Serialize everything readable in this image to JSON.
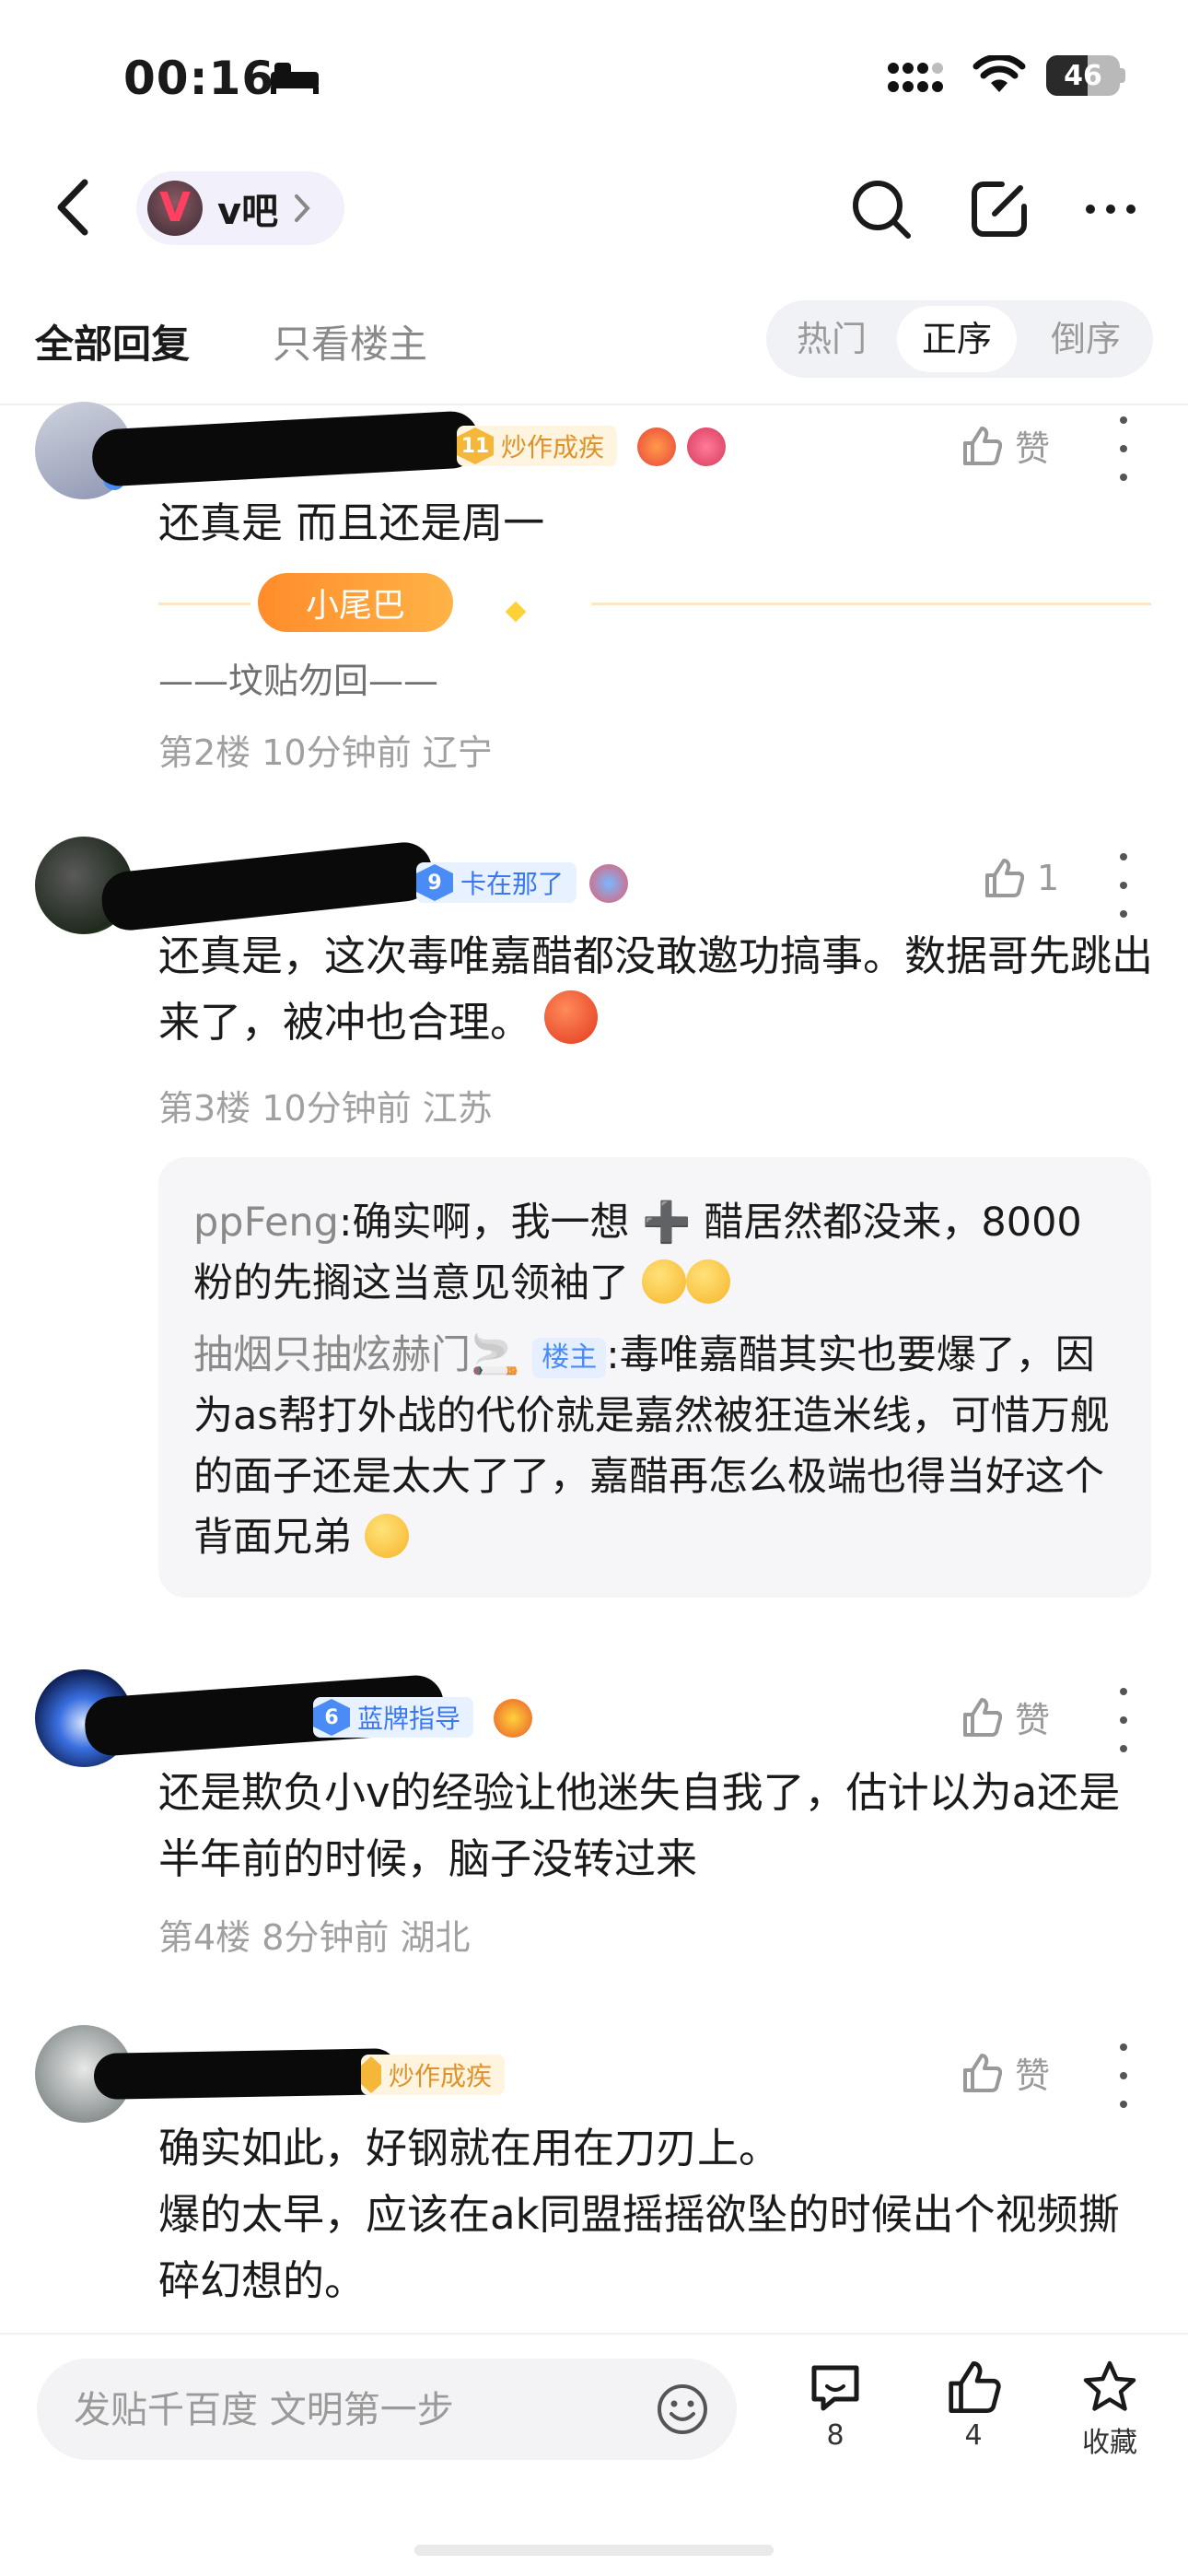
{
  "status_bar": {
    "time": "00:16",
    "battery": "46"
  },
  "nav": {
    "forum_name": "v吧"
  },
  "tabs": {
    "all_replies": "全部回复",
    "op_only": "只看楼主"
  },
  "sort": {
    "hot": "热门",
    "asc": "正序",
    "desc": "倒序",
    "selected": "正序"
  },
  "posts": [
    {
      "level": "11",
      "title": "炒作成疾",
      "likes": "赞",
      "text": "还真是 而且还是周一",
      "tail_badge": "小尾巴",
      "signature": "——坟贴勿回——",
      "meta": "第2楼 10分钟前 辽宁"
    },
    {
      "level": "9",
      "title": "卡在那了",
      "likes": "1",
      "text": "还真是，这次毒唯嘉醋都没敢邀功搞事。数据哥先跳出来了，被冲也合理。",
      "meta": "第3楼 10分钟前 江苏",
      "replies": [
        {
          "author": "ppFeng",
          "text": ":确实啊，我一想 ➕ 醋居然都没来，8000粉的先搁这当意见领袖了"
        },
        {
          "author": "抽烟只抽炫赫门🚬",
          "op_tag": "楼主",
          "text": ":毒唯嘉醋其实也要爆了，因为as帮打外战的代价就是嘉然被狂造米线，可惜万舰的面子还是太大了了，嘉醋再怎么极端也得当好这个背面兄弟"
        }
      ]
    },
    {
      "level": "6",
      "title": "蓝牌指导",
      "likes": "赞",
      "text": "还是欺负小v的经验让他迷失自我了，估计以为a还是半年前的时候，脑子没转过来",
      "meta": "第4楼 8分钟前 湖北"
    },
    {
      "title": "炒作成疾",
      "likes": "赞",
      "text": "确实如此，好钢就在用在刀刃上。\n爆的太早，应该在ak同盟摇摇欲坠的时候出个视频撕碎幻想的。"
    }
  ],
  "bottom_bar": {
    "input_placeholder": "发贴千百度 文明第一步",
    "comments": "8",
    "likes": "4",
    "favorite": "收藏"
  },
  "colors": {
    "accent_blue": "#4b8bf6",
    "gold": "#e0922a",
    "muted": "#a0a0a0"
  }
}
